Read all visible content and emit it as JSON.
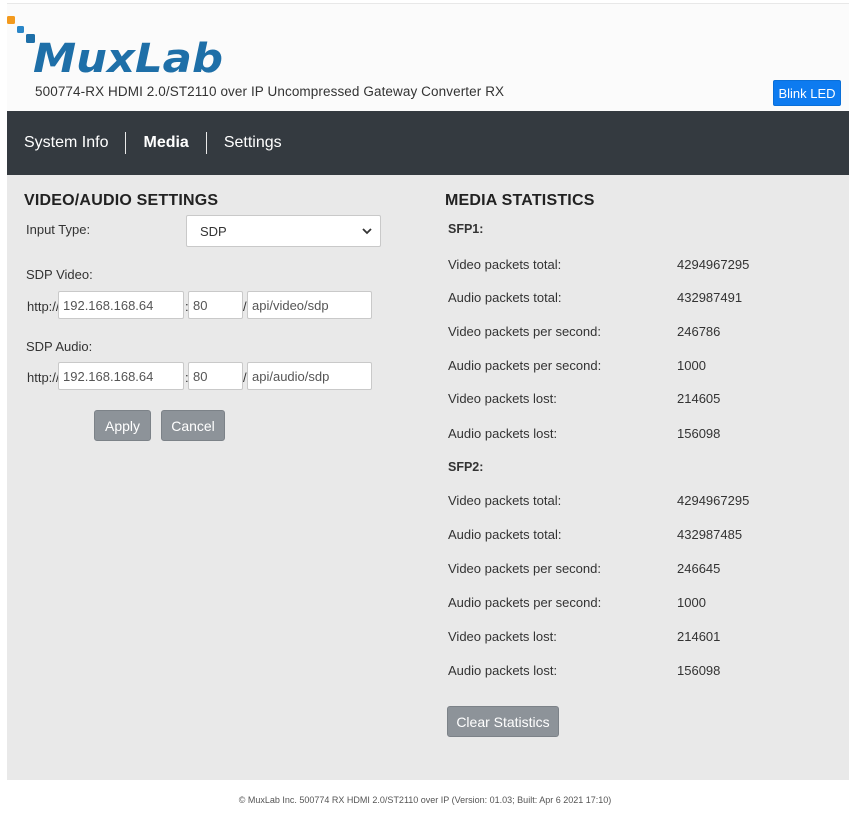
{
  "header": {
    "logo_text": "MuxLab",
    "subtitle": "500774-RX HDMI 2.0/ST2110 over IP Uncompressed Gateway Converter RX",
    "blink_led_label": "Blink LED"
  },
  "nav": {
    "items": [
      {
        "label": "System Info"
      },
      {
        "label": "Media"
      },
      {
        "label": "Settings"
      }
    ],
    "active": "Media"
  },
  "settings": {
    "title": "VIDEO/AUDIO SETTINGS",
    "input_type_label": "Input Type:",
    "input_type_value": "SDP",
    "sdp_video_label": "SDP Video:",
    "sdp_video": {
      "prefix": "http://",
      "host": "192.168.168.64",
      "colon": ":",
      "port": "80",
      "slash": "/",
      "path": "api/video/sdp"
    },
    "sdp_audio_label": "SDP Audio:",
    "sdp_audio": {
      "prefix": "http://",
      "host": "192.168.168.64",
      "colon": ":",
      "port": "80",
      "slash": "/",
      "path": "api/audio/sdp"
    },
    "apply_label": "Apply",
    "cancel_label": "Cancel"
  },
  "stats": {
    "title": "MEDIA STATISTICS",
    "sfp1": {
      "heading": "SFP1:",
      "rows": [
        {
          "label": "Video packets total:",
          "value": "4294967295"
        },
        {
          "label": "Audio packets total:",
          "value": "432987491"
        },
        {
          "label": "Video packets per second:",
          "value": "246786"
        },
        {
          "label": "Audio packets per second:",
          "value": "1000"
        },
        {
          "label": "Video packets lost:",
          "value": "214605"
        },
        {
          "label": "Audio packets lost:",
          "value": "156098"
        }
      ]
    },
    "sfp2": {
      "heading": "SFP2:",
      "rows": [
        {
          "label": "Video packets total:",
          "value": "4294967295"
        },
        {
          "label": "Audio packets total:",
          "value": "432987485"
        },
        {
          "label": "Video packets per second:",
          "value": "246645"
        },
        {
          "label": "Audio packets per second:",
          "value": "1000"
        },
        {
          "label": "Video packets lost:",
          "value": "214601"
        },
        {
          "label": "Audio packets lost:",
          "value": "156098"
        }
      ]
    },
    "clear_label": "Clear Statistics"
  },
  "footer": {
    "text": "© MuxLab Inc. 500774 RX HDMI 2.0/ST2110 over IP (Version: 01.03; Built: Apr 6 2021 17:10)"
  },
  "colors": {
    "brand_blue": "#1e6fa8",
    "brand_orange": "#f39a1e",
    "accent_button": "#0d7bf0",
    "nav_bg": "#343a40",
    "panel_bg": "#e9e9e9",
    "secondary_button": "#8d9399"
  }
}
